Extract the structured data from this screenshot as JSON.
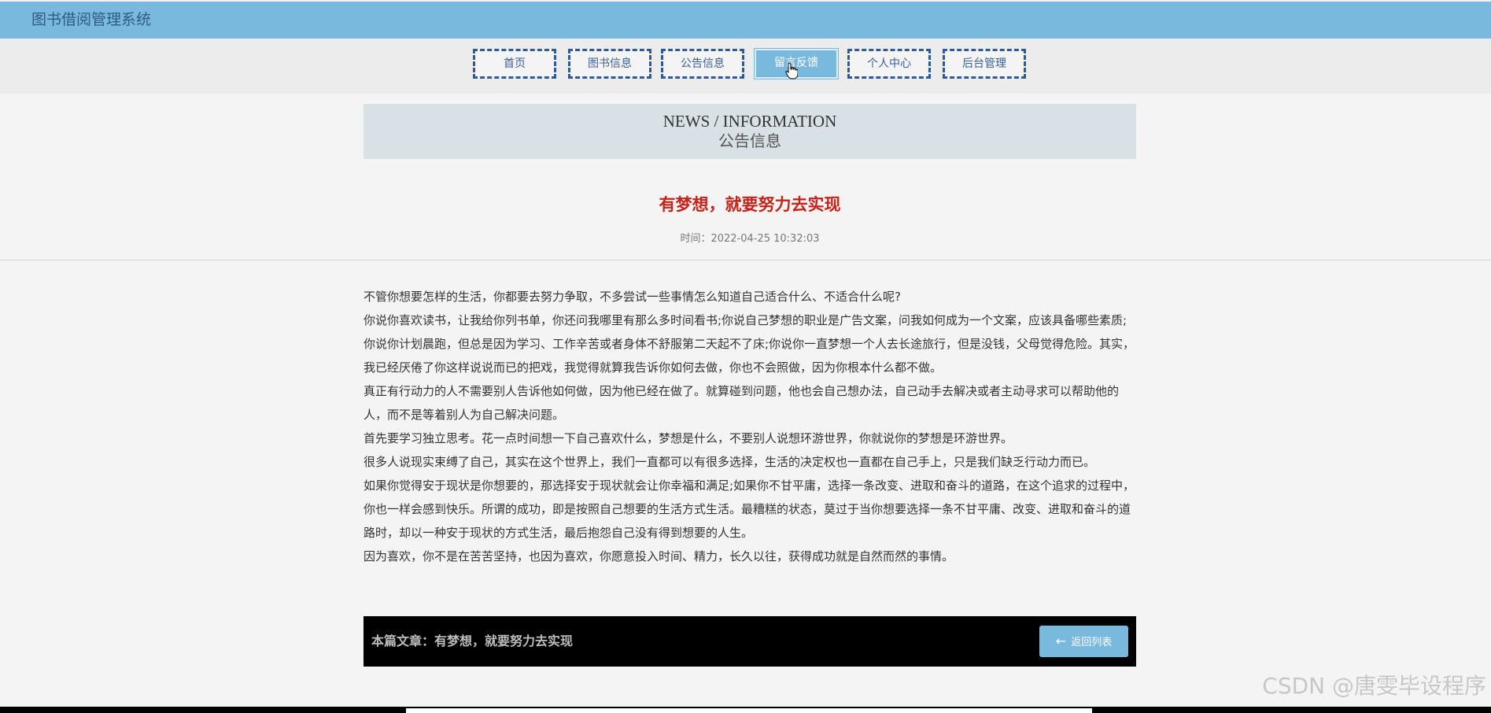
{
  "header": {
    "title": "图书借阅管理系统"
  },
  "nav": {
    "items": [
      {
        "label": "首页"
      },
      {
        "label": "图书信息"
      },
      {
        "label": "公告信息"
      },
      {
        "label": "留言反馈"
      },
      {
        "label": "个人中心"
      },
      {
        "label": "后台管理"
      }
    ],
    "active": "留言反馈"
  },
  "banner": {
    "en": "NEWS / INFORMATION",
    "cn": "公告信息"
  },
  "article": {
    "title": "有梦想，就要努力去实现",
    "time": "时间：2022-04-25 10:32:03",
    "paragraphs": [
      "不管你想要怎样的生活，你都要去努力争取，不多尝试一些事情怎么知道自己适合什么、不适合什么呢?",
      "你说你喜欢读书，让我给你列书单，你还问我哪里有那么多时间看书;你说自己梦想的职业是广告文案，问我如何成为一个文案，应该具备哪些素质;你说你计划晨跑，但总是因为学习、工作辛苦或者身体不舒服第二天起不了床;你说你一直梦想一个人去长途旅行，但是没钱，父母觉得危险。其实，我已经厌倦了你这样说说而已的把戏，我觉得就算我告诉你如何去做，你也不会照做，因为你根本什么都不做。",
      "真正有行动力的人不需要别人告诉他如何做，因为他已经在做了。就算碰到问题，他也会自己想办法，自己动手去解决或者主动寻求可以帮助他的人，而不是等着别人为自己解决问题。",
      "首先要学习独立思考。花一点时间想一下自己喜欢什么，梦想是什么，不要别人说想环游世界，你就说你的梦想是环游世界。",
      "很多人说现实束缚了自己，其实在这个世界上，我们一直都可以有很多选择，生活的决定权也一直都在自己手上，只是我们缺乏行动力而已。",
      "如果你觉得安于现状是你想要的，那选择安于现状就会让你幸福和满足;如果你不甘平庸，选择一条改变、进取和奋斗的道路，在这个追求的过程中，你也一样会感到快乐。所谓的成功，即是按照自己想要的生活方式生活。最糟糕的状态，莫过于当你想要选择一条不甘平庸、改变、进取和奋斗的道路时，却以一种安于现状的方式生活，最后抱怨自己没有得到想要的人生。",
      "因为喜欢，你不是在苦苦坚持，也因为喜欢，你愿意投入时间、精力，长久以往，获得成功就是自然而然的事情。"
    ]
  },
  "footer": {
    "current_article": "本篇文章：有梦想，就要努力去实现",
    "back_label": "返回列表"
  },
  "watermark": "CSDN @唐雯毕设程序",
  "colors": {
    "header_bg": "#7ab9de",
    "title_red": "#c7231b",
    "nav_border": "#2e5a9a"
  }
}
